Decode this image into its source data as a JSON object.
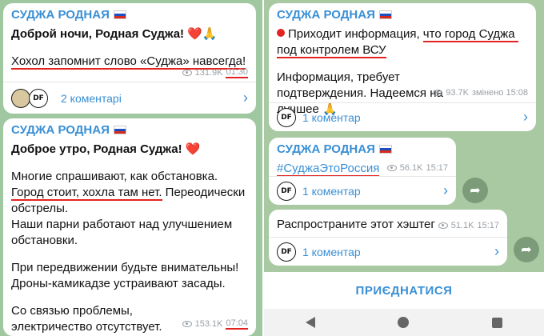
{
  "channel_name": "СУДЖА РОДНАЯ",
  "left": {
    "post1": {
      "line1": "Доброй ночи, Родная Суджа! ",
      "line1_emoji": "❤️🙏",
      "line2": "Хохол запомнит слово «Суджа» навсегда!",
      "views": "131.9K",
      "time": "01:30",
      "comments_label": "2 коментарі",
      "avatar_1": "DF"
    },
    "post2": {
      "title": "Доброе утро, Родная Суджа! ",
      "title_emoji": "❤️",
      "p1_a": "Многие спрашивают, как обстановка.",
      "p1_b_underlined": "Город стоит, хохла там нет.",
      "p1_c": " Переодически обстрелы.",
      "p1_d": "Наши парни работают над улучшением обстановки.",
      "p2": "При передвижении будьте внимательны! Дроны-камикадзе устраивают засады.",
      "p3": "Со связью проблемы, электричество отсутствует.",
      "views": "153.1K",
      "time": "07:04"
    }
  },
  "right": {
    "post1": {
      "text_a": "Приходит информация, ",
      "text_b_underlined": "что город Суджа под контролем ВСУ",
      "text_c": "Информация, требует подтверждения. Надеемся на лучшее ",
      "text_c_emoji": "🙏",
      "views": "93.7K",
      "time": "змінено 15:08",
      "comments_label": "1 коментар",
      "avatar": "DF"
    },
    "post2": {
      "hashtag": "#СуджаЭтоРоссия",
      "views": "56.1K",
      "time": "15:17",
      "comments_label": "1 коментар",
      "avatar": "DF"
    },
    "post3": {
      "text": "Распространите этот хэштег",
      "views": "51.1K",
      "time": "15:17",
      "comments_label": "1 коментар",
      "avatar": "DF"
    },
    "join_label": "ПРИЄДНАТИСЯ"
  },
  "colors": {
    "accent": "#3a8fd4",
    "underline": "#e32222",
    "bg_left": "#9fc7a0",
    "bg_right": "#a8c9a2"
  }
}
